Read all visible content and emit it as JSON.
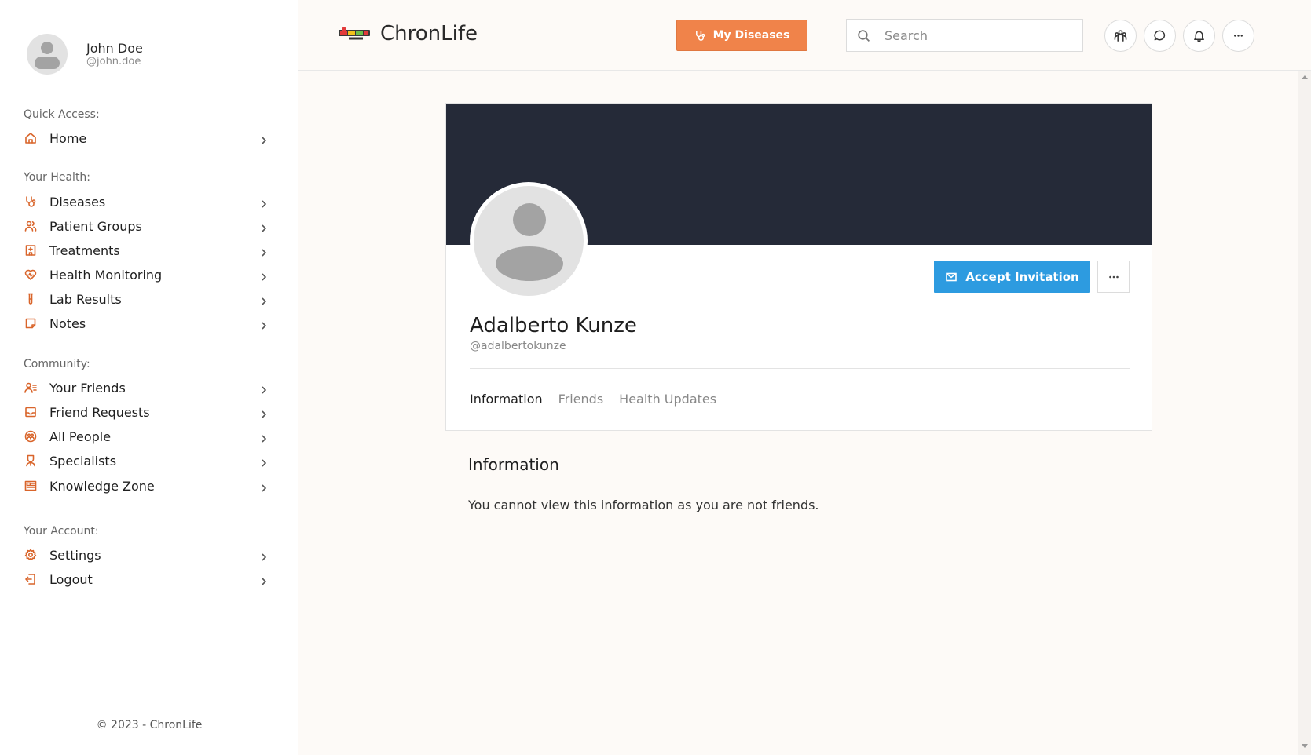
{
  "user": {
    "name": "John Doe",
    "handle": "@john.doe"
  },
  "sidebar": {
    "sections": [
      {
        "label": "Quick Access:",
        "items": [
          {
            "label": "Home",
            "icon": "home-icon"
          }
        ]
      },
      {
        "label": "Your Health:",
        "items": [
          {
            "label": "Diseases",
            "icon": "stethoscope-icon"
          },
          {
            "label": "Patient Groups",
            "icon": "users-icon"
          },
          {
            "label": "Treatments",
            "icon": "hospital-icon"
          },
          {
            "label": "Health Monitoring",
            "icon": "heart-pulse-icon"
          },
          {
            "label": "Lab Results",
            "icon": "test-tube-icon"
          },
          {
            "label": "Notes",
            "icon": "note-icon"
          }
        ]
      },
      {
        "label": "Community:",
        "items": [
          {
            "label": "Your Friends",
            "icon": "user-list-icon"
          },
          {
            "label": "Friend Requests",
            "icon": "inbox-icon"
          },
          {
            "label": "All People",
            "icon": "globe-people-icon"
          },
          {
            "label": "Specialists",
            "icon": "specialist-icon"
          },
          {
            "label": "Knowledge Zone",
            "icon": "newspaper-icon"
          }
        ]
      },
      {
        "label": "Your Account:",
        "items": [
          {
            "label": "Settings",
            "icon": "gear-icon"
          },
          {
            "label": "Logout",
            "icon": "logout-icon"
          }
        ]
      }
    ],
    "footer": "© 2023 - ChronLife"
  },
  "header": {
    "logo_text": "ChronLife",
    "my_diseases_label": "My Diseases",
    "search_placeholder": "Search"
  },
  "profile": {
    "name": "Adalberto Kunze",
    "handle": "@adalbertokunze",
    "accept_label": "Accept Invitation",
    "tabs": [
      "Information",
      "Friends",
      "Health Updates"
    ],
    "active_tab": "Information"
  },
  "info": {
    "title": "Information",
    "text": "You cannot view this information as you are not friends."
  },
  "colors": {
    "accent": "#f0834a",
    "icon_accent": "#d9652b",
    "primary": "#2d9be0",
    "cover": "#252a38"
  }
}
